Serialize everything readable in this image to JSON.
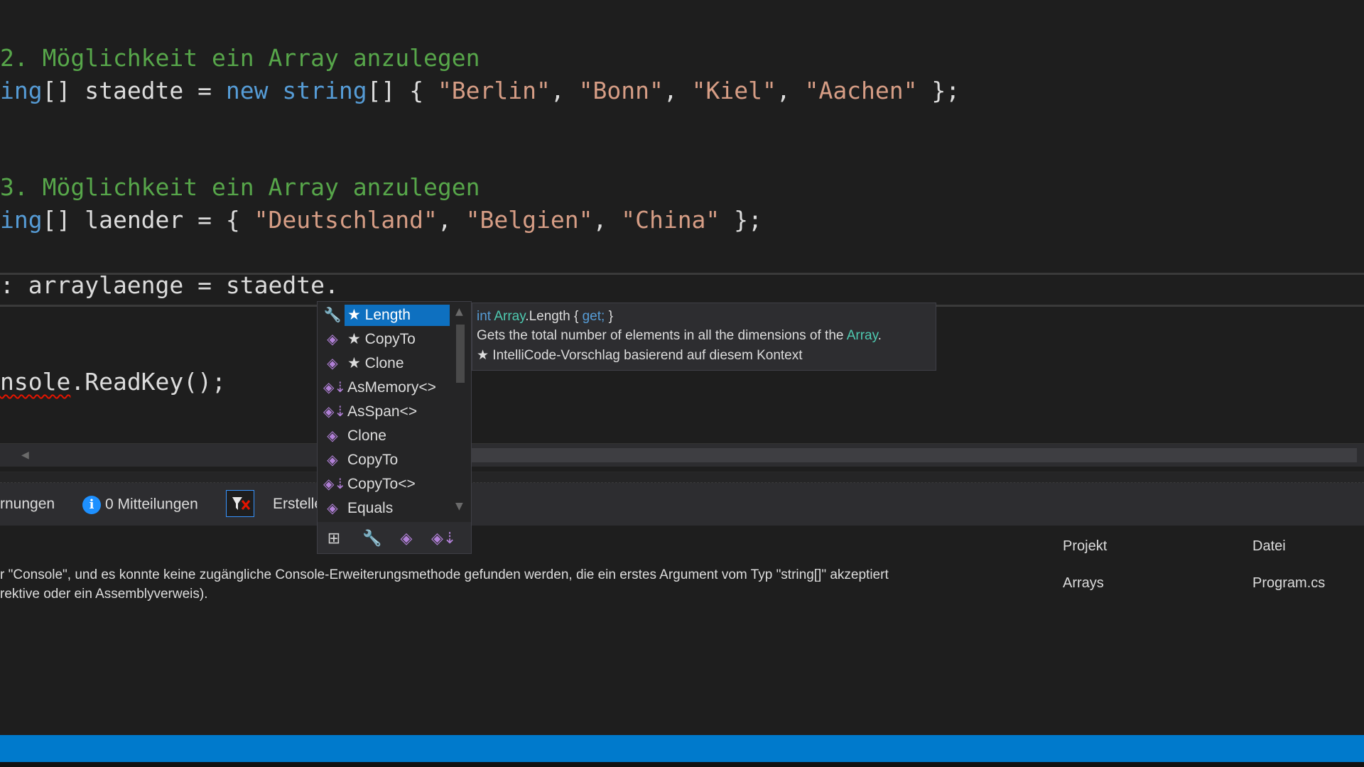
{
  "editor": {
    "comment2": "2. Möglichkeit ein Array anzulegen",
    "line2": {
      "type_partial": "ing",
      "brackets": "[] staedte = ",
      "kw_new": "new",
      "type_string": "string",
      "rest_open": "[] { ",
      "s1": "\"Berlin\"",
      "s2": "\"Bonn\"",
      "s3": "\"Kiel\"",
      "s4": "\"Aachen\"",
      "comma": ", ",
      "close": " };"
    },
    "comment3": "3. Möglichkeit ein Array anzulegen",
    "line3": {
      "type_partial": "ing",
      "rest": "[] laender = { ",
      "s1": "\"Deutschland\"",
      "s2": "\"Belgien\"",
      "s3": "\"China\"",
      "comma": ", ",
      "close": " };"
    },
    "current_line": ": arraylaenge = staedte.",
    "readkey_squiggle": "nsole",
    "readkey_rest": ".ReadKey();"
  },
  "intellisense": {
    "items": [
      {
        "label": "★ Length",
        "icon": "wrench-icon",
        "selected": true
      },
      {
        "label": "★ CopyTo",
        "icon": "method-cube-icon"
      },
      {
        "label": "★ Clone",
        "icon": "method-cube-icon"
      },
      {
        "label": "AsMemory<>",
        "icon": "extension-method-icon"
      },
      {
        "label": "AsSpan<>",
        "icon": "extension-method-icon"
      },
      {
        "label": "Clone",
        "icon": "method-cube-icon"
      },
      {
        "label": "CopyTo",
        "icon": "method-cube-icon"
      },
      {
        "label": "CopyTo<>",
        "icon": "extension-method-icon"
      },
      {
        "label": "Equals",
        "icon": "method-cube-icon"
      }
    ],
    "filter_icons": [
      "expand-filter-icon",
      "property-filter-icon",
      "method-filter-icon",
      "extension-filter-icon"
    ]
  },
  "tooltip": {
    "sig_type": "int",
    "sig_class": "Array",
    "sig_member": ".Length { ",
    "sig_get": "get;",
    "sig_end": " }",
    "desc_pre": "Gets the total number of elements in all the dimensions of the ",
    "desc_class": "Array",
    "desc_end": ".",
    "intellicode": "★  IntelliCode-Vorschlag basierend auf diesem Kontext"
  },
  "error_list": {
    "warnings_label": "rnungen",
    "messages_label": "0 Mitteilungen",
    "build_label": "Erstelle",
    "col_project": "Projekt",
    "col_file": "Datei",
    "error_line1": "r \"Console\", und es konnte keine zugängliche Console-Erweiterungsmethode gefunden werden, die ein erstes Argument vom Typ \"string[]\" akzeptiert",
    "error_line2": "rektive oder ein Assemblyverweis).",
    "project": "Arrays",
    "file": "Program.cs"
  },
  "colors": {
    "accent": "#007acc",
    "selection": "#0e70c0",
    "comment": "#57a64a",
    "keyword": "#569cd6",
    "string": "#d69d85"
  }
}
